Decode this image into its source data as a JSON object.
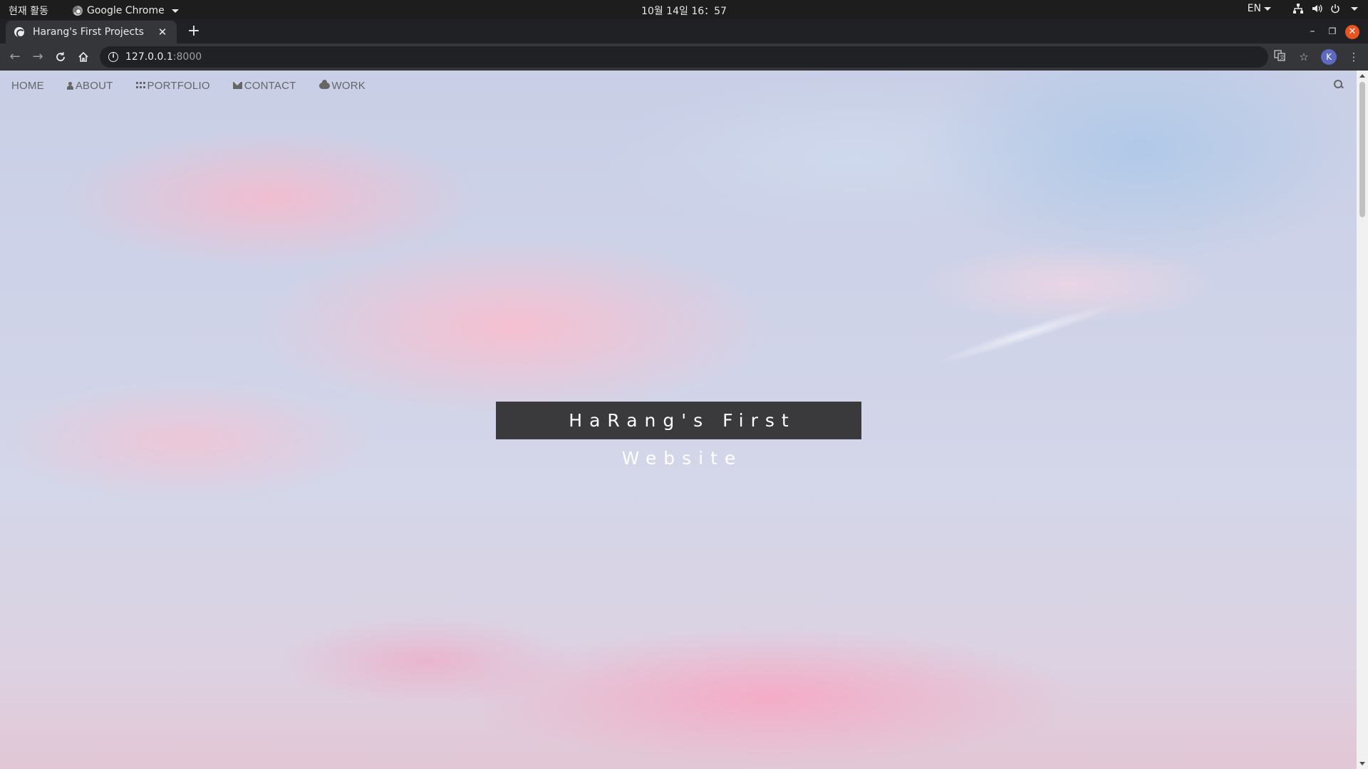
{
  "os_topbar": {
    "activities": "현재 활동",
    "app_name": "Google Chrome",
    "clock": "10월 14일 16：57",
    "language": "EN"
  },
  "browser": {
    "tab_title": "Harang's First Projects",
    "tab_close": "✕",
    "new_tab": "+",
    "url_host": "127.0.0.1",
    "url_port": ":8000",
    "profile_initial": "K"
  },
  "site": {
    "nav": {
      "home": "HOME",
      "about": "ABOUT",
      "portfolio": "PORTFOLIO",
      "contact": "CONTACT",
      "work": "WORK"
    },
    "hero_title": "HaRang's First Website"
  },
  "colors": {
    "hero_box": "#3a3a3c",
    "nav_text": "#666666",
    "close_button": "#e95420",
    "profile_avatar": "#5c6bc0"
  }
}
